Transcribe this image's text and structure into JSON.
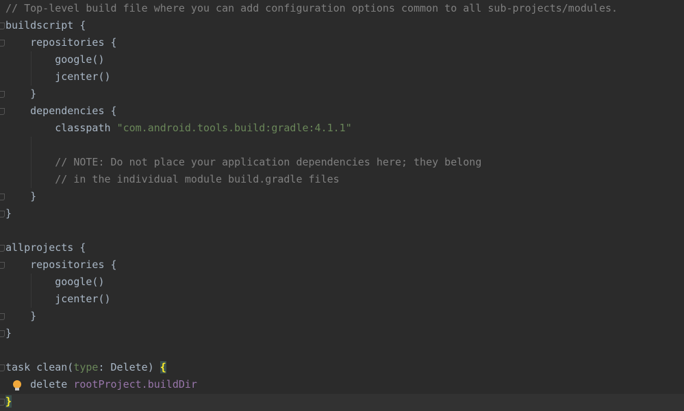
{
  "editor": {
    "lines": [
      [
        {
          "t": "// Top-level build file where you can add configuration options common to all sub-projects/modules.",
          "k": "comment"
        }
      ],
      [
        {
          "t": "buildscript {",
          "k": "plain"
        }
      ],
      [
        {
          "t": "    repositories {",
          "k": "plain"
        }
      ],
      [
        {
          "t": "        google()",
          "k": "plain"
        }
      ],
      [
        {
          "t": "        jcenter()",
          "k": "plain"
        }
      ],
      [
        {
          "t": "    }",
          "k": "plain"
        }
      ],
      [
        {
          "t": "    dependencies {",
          "k": "plain"
        }
      ],
      [
        {
          "t": "        classpath ",
          "k": "plain"
        },
        {
          "t": "\"com.android.tools.build:gradle:4.1.1\"",
          "k": "string"
        }
      ],
      [],
      [
        {
          "t": "        // NOTE: Do not place your application dependencies here; they belong",
          "k": "comment"
        }
      ],
      [
        {
          "t": "        // in the individual module build.gradle files",
          "k": "comment"
        }
      ],
      [
        {
          "t": "    }",
          "k": "plain"
        }
      ],
      [
        {
          "t": "}",
          "k": "plain"
        }
      ],
      [],
      [
        {
          "t": "allprojects {",
          "k": "plain"
        }
      ],
      [
        {
          "t": "    repositories {",
          "k": "plain"
        }
      ],
      [
        {
          "t": "        google()",
          "k": "plain"
        }
      ],
      [
        {
          "t": "        jcenter()",
          "k": "plain"
        }
      ],
      [
        {
          "t": "    }",
          "k": "plain"
        }
      ],
      [
        {
          "t": "}",
          "k": "plain"
        }
      ],
      [],
      [
        {
          "t": "task clean(",
          "k": "plain"
        },
        {
          "t": "type",
          "k": "param"
        },
        {
          "t": ": Delete) ",
          "k": "plain"
        },
        {
          "t": "{",
          "k": "brace-match"
        }
      ],
      [
        {
          "t": "    delete ",
          "k": "plain"
        },
        {
          "t": "rootProject.buildDir",
          "k": "field"
        }
      ],
      [
        {
          "t": "}",
          "k": "brace-match"
        }
      ]
    ],
    "caret_line": 24,
    "intention_icon": "lightbulb-icon"
  }
}
